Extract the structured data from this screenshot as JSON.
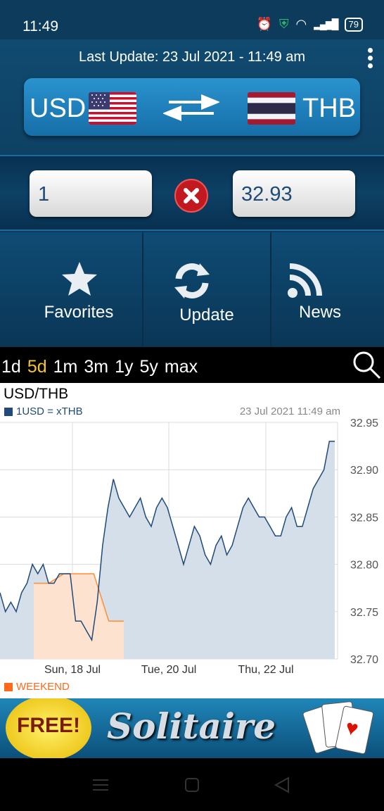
{
  "status": {
    "time": "11:49",
    "battery": "79"
  },
  "header": {
    "last_update": "Last Update: 23 Jul 2021 - 11:49 am"
  },
  "pair": {
    "from": "USD",
    "to": "THB"
  },
  "inputs": {
    "amount": "1",
    "result": "32.93"
  },
  "nav": {
    "favorites": "Favorites",
    "update": "Update",
    "news": "News"
  },
  "ranges": {
    "options": [
      "1d",
      "5d",
      "1m",
      "3m",
      "1y",
      "5y",
      "max"
    ],
    "active": "5d"
  },
  "chart": {
    "title": "USD/THB",
    "legend": "1USD = xTHB",
    "stamp": "23 Jul 2021 11:49 am",
    "weekend_label": "WEEKEND"
  },
  "chart_data": {
    "type": "area",
    "ylim": [
      32.7,
      32.95
    ],
    "yticks": [
      "32.95",
      "32.90",
      "32.85",
      "32.80",
      "32.75",
      "32.70"
    ],
    "xticks": [
      "Sun, 18 Jul",
      "Tue, 20 Jul",
      "Thu, 22 Jul"
    ],
    "series": [
      {
        "name": "1USD = xTHB",
        "points": [
          32.77,
          32.75,
          32.76,
          32.75,
          32.77,
          32.78,
          32.8,
          32.79,
          32.8,
          32.78,
          32.78,
          32.79,
          32.79,
          32.79,
          32.74,
          32.74,
          32.73,
          32.72,
          32.76,
          32.82,
          32.86,
          32.89,
          32.87,
          32.86,
          32.85,
          32.86,
          32.87,
          32.85,
          32.84,
          32.86,
          32.87,
          32.86,
          32.84,
          32.82,
          32.8,
          32.82,
          32.84,
          32.83,
          32.81,
          32.8,
          32.82,
          32.83,
          32.81,
          32.82,
          32.84,
          32.86,
          32.87,
          32.86,
          32.85,
          32.85,
          32.84,
          32.83,
          32.83,
          32.85,
          32.86,
          32.84,
          32.84,
          32.86,
          32.88,
          32.89,
          32.9,
          32.93,
          32.93
        ]
      },
      {
        "name": "WEEKEND",
        "points": [
          32.78,
          32.78,
          32.79,
          32.79,
          32.79,
          32.74,
          32.74
        ]
      }
    ]
  },
  "ad": {
    "badge": "FREE!",
    "title": "Solitaire"
  },
  "colors": {
    "accent": "#f4c430",
    "series": "#1f4a79",
    "weekend": "#ff6a1a",
    "area": "#d5dfe9"
  }
}
